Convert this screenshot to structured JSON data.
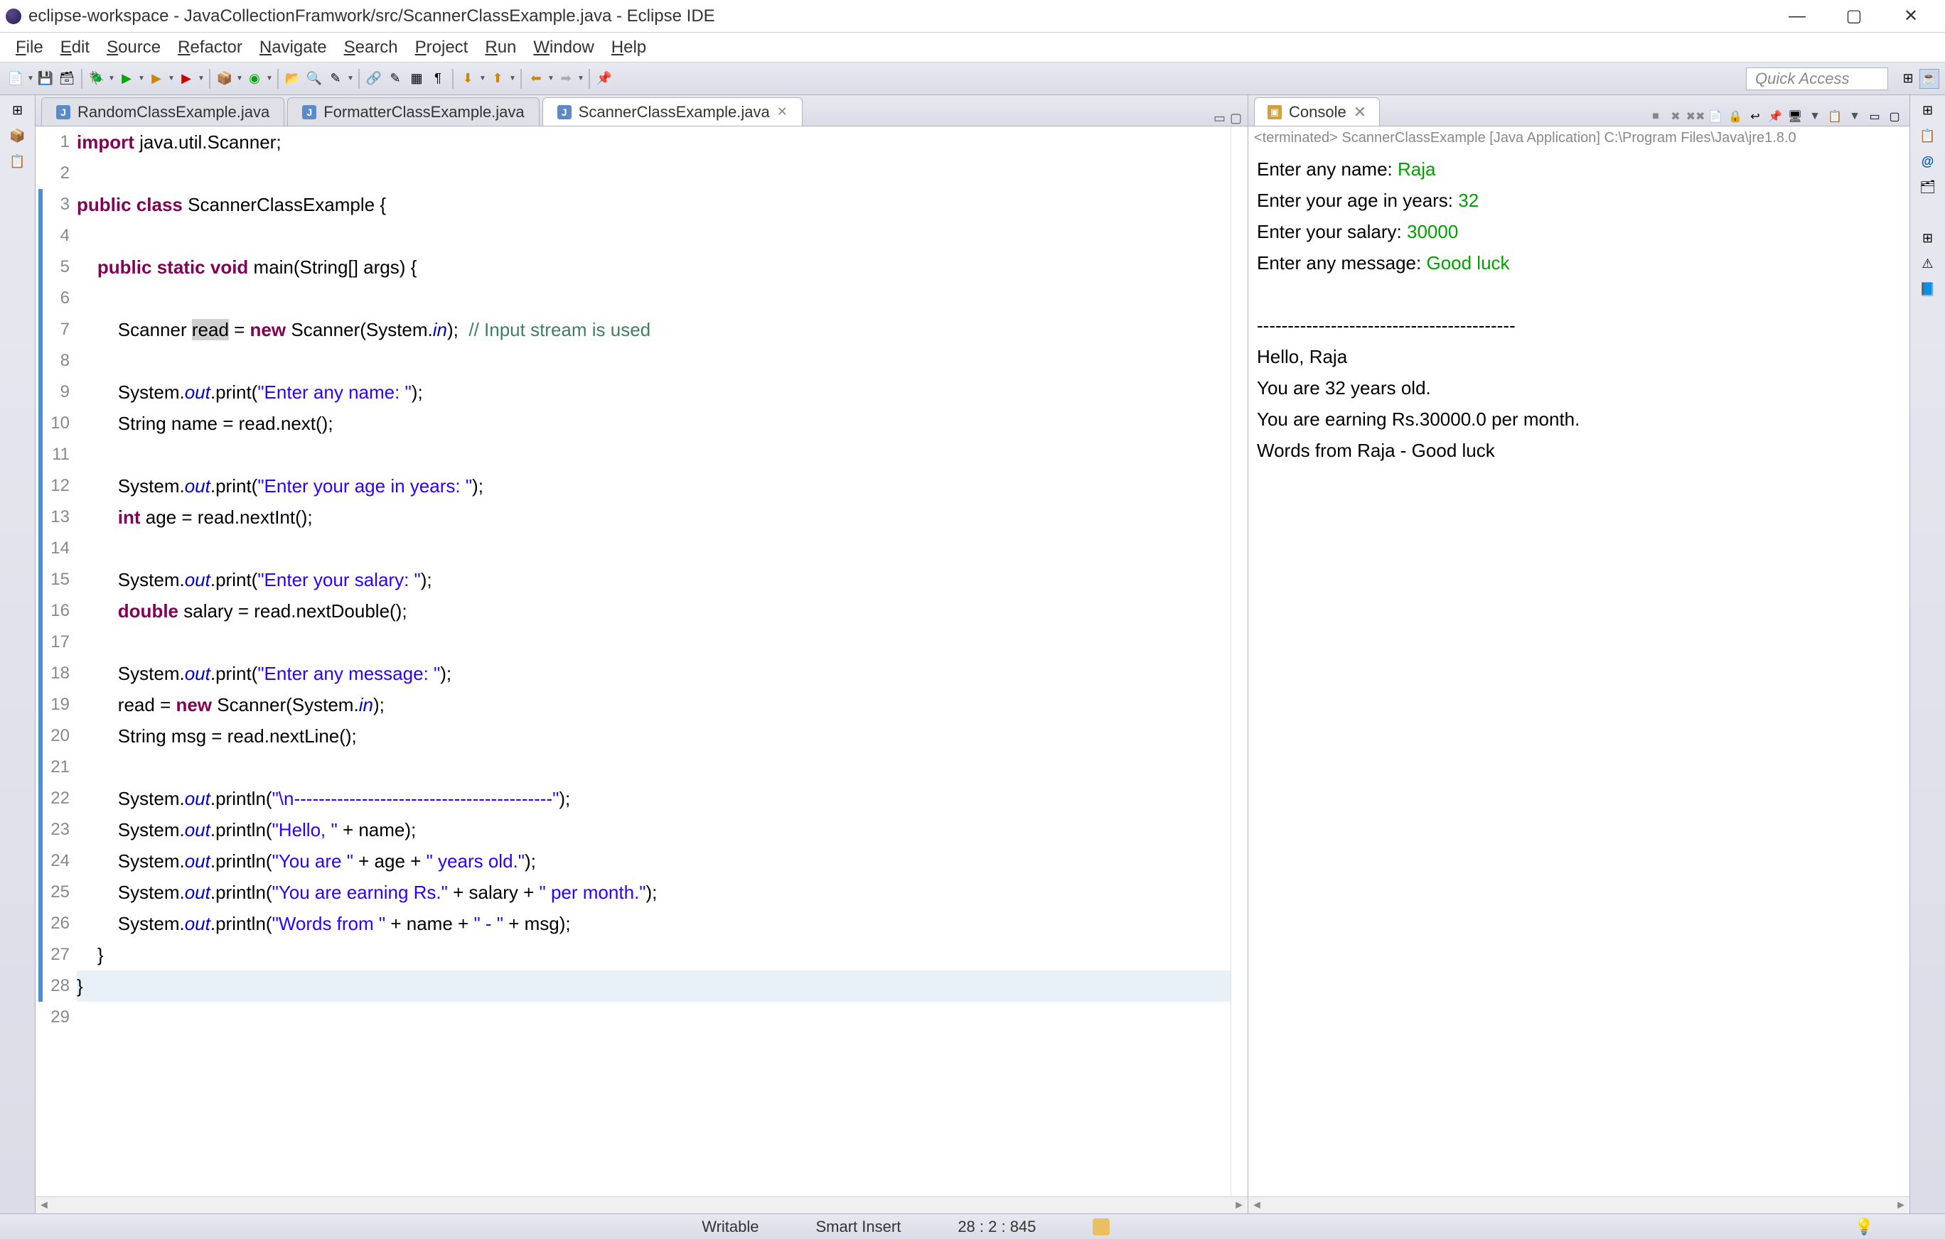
{
  "window": {
    "title": "eclipse-workspace - JavaCollectionFramwork/src/ScannerClassExample.java - Eclipse IDE"
  },
  "menus": [
    "File",
    "Edit",
    "Source",
    "Refactor",
    "Navigate",
    "Search",
    "Project",
    "Run",
    "Window",
    "Help"
  ],
  "quick_access": "Quick Access",
  "tabs": [
    {
      "label": "RandomClassExample.java",
      "active": false
    },
    {
      "label": "FormatterClassExample.java",
      "active": false
    },
    {
      "label": "ScannerClassExample.java",
      "active": true
    }
  ],
  "code_lines": [
    {
      "n": 1,
      "html": "<span class='kw'>import</span> java.util.Scanner;"
    },
    {
      "n": 2,
      "html": ""
    },
    {
      "n": 3,
      "html": "<span class='kw'>public</span> <span class='kw'>class</span> ScannerClassExample {"
    },
    {
      "n": 4,
      "html": ""
    },
    {
      "n": 5,
      "html": "    <span class='kw'>public</span> <span class='kw'>static</span> <span class='kw'>void</span> main(String[] args) {"
    },
    {
      "n": 6,
      "html": ""
    },
    {
      "n": 7,
      "html": "        Scanner <span style='background:#d0d0d0'>read</span> = <span class='kw'>new</span> Scanner(System.<span class='fld'>in</span>);  <span class='cmt'>// Input stream is used</span>"
    },
    {
      "n": 8,
      "html": ""
    },
    {
      "n": 9,
      "html": "        System.<span class='fld'>out</span>.print(<span class='str'>\"Enter any name: \"</span>);"
    },
    {
      "n": 10,
      "html": "        String name = read.next();"
    },
    {
      "n": 11,
      "html": ""
    },
    {
      "n": 12,
      "html": "        System.<span class='fld'>out</span>.print(<span class='str'>\"Enter your age in years: \"</span>);"
    },
    {
      "n": 13,
      "html": "        <span class='kw'>int</span> age = read.nextInt();"
    },
    {
      "n": 14,
      "html": ""
    },
    {
      "n": 15,
      "html": "        System.<span class='fld'>out</span>.print(<span class='str'>\"Enter your salary: \"</span>);"
    },
    {
      "n": 16,
      "html": "        <span class='kw'>double</span> salary = read.nextDouble();"
    },
    {
      "n": 17,
      "html": ""
    },
    {
      "n": 18,
      "html": "        System.<span class='fld'>out</span>.print(<span class='str'>\"Enter any message: \"</span>);"
    },
    {
      "n": 19,
      "html": "        read = <span class='kw'>new</span> Scanner(System.<span class='fld'>in</span>);"
    },
    {
      "n": 20,
      "html": "        String msg = read.nextLine();"
    },
    {
      "n": 21,
      "html": ""
    },
    {
      "n": 22,
      "html": "        System.<span class='fld'>out</span>.println(<span class='str'>\"\\n------------------------------------------\"</span>);"
    },
    {
      "n": 23,
      "html": "        System.<span class='fld'>out</span>.println(<span class='str'>\"Hello, \"</span> + name);"
    },
    {
      "n": 24,
      "html": "        System.<span class='fld'>out</span>.println(<span class='str'>\"You are \"</span> + age + <span class='str'>\" years old.\"</span>);"
    },
    {
      "n": 25,
      "html": "        System.<span class='fld'>out</span>.println(<span class='str'>\"You are earning Rs.\"</span> + salary + <span class='str'>\" per month.\"</span>);"
    },
    {
      "n": 26,
      "html": "        System.<span class='fld'>out</span>.println(<span class='str'>\"Words from \"</span> + name + <span class='str'>\" - \"</span> + msg);"
    },
    {
      "n": 27,
      "html": "    }"
    },
    {
      "n": 28,
      "html": "}",
      "current": true
    },
    {
      "n": 29,
      "html": ""
    }
  ],
  "console": {
    "tab_label": "Console",
    "header": "<terminated> ScannerClassExample [Java Application] C:\\Program Files\\Java\\jre1.8.0",
    "lines": [
      {
        "prompt": "Enter any name: ",
        "input": "Raja"
      },
      {
        "prompt": "Enter your age in years: ",
        "input": "32"
      },
      {
        "prompt": "Enter your salary: ",
        "input": "30000"
      },
      {
        "prompt": "Enter any message: ",
        "input": "Good luck"
      },
      {
        "text": ""
      },
      {
        "text": "------------------------------------------"
      },
      {
        "text": "Hello, Raja"
      },
      {
        "text": "You are 32 years old."
      },
      {
        "text": "You are earning Rs.30000.0 per month."
      },
      {
        "text": "Words from Raja - Good luck"
      }
    ]
  },
  "status": {
    "writable": "Writable",
    "smart_insert": "Smart Insert",
    "cursor": "28 : 2 : 845"
  }
}
